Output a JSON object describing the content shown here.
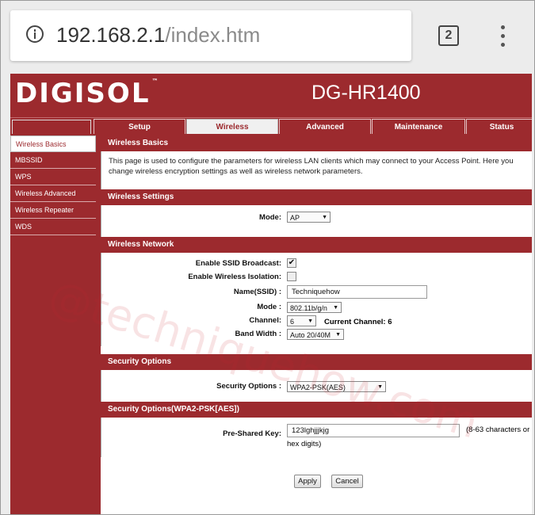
{
  "browser": {
    "url_host": "192.168.2.1",
    "url_path": "/index.htm",
    "tab_count": "2"
  },
  "header": {
    "logo": "DIGISOL",
    "logo_mark": "™",
    "model": "DG-HR1400"
  },
  "nav": {
    "tabs": [
      "Setup",
      "Wireless",
      "Advanced",
      "Maintenance",
      "Status"
    ],
    "active": "Wireless"
  },
  "sidebar": {
    "items": [
      "Wireless Basics",
      "MBSSID",
      "WPS",
      "Wireless Advanced",
      "Wireless Repeater",
      "WDS"
    ],
    "active": "Wireless Basics"
  },
  "sections": {
    "basics": {
      "title": "Wireless Basics",
      "text_line1": "This page is used to configure the parameters for wireless LAN clients which may connect to your Access Point. Here you",
      "text_line2": "change wireless encryption settings as well as wireless network parameters."
    },
    "settings": {
      "title": "Wireless Settings",
      "mode_label": "Mode:",
      "mode_value": "AP"
    },
    "network": {
      "title": "Wireless Network",
      "ssid_broadcast_label": "Enable SSID Broadcast:",
      "ssid_broadcast_checked": "✔",
      "isolation_label": "Enable Wireless Isolation:",
      "ssid_label": "Name(SSID) :",
      "ssid_value": "Techniquehow",
      "mode_label": "Mode :",
      "mode_value": "802.11b/g/n",
      "channel_label": "Channel:",
      "channel_value": "6",
      "current_channel_label": "Current Channel: 6",
      "bandwidth_label": "Band Width :",
      "bandwidth_value": "Auto 20/40M"
    },
    "security": {
      "title": "Security Options",
      "label": "Security Options :",
      "value": "WPA2-PSK(AES)"
    },
    "wpa": {
      "title": "Security Options(WPA2-PSK[AES])",
      "psk_label": "Pre-Shared Key:",
      "psk_value": "123lghjjjkjg",
      "hint_line1": "(8-63 characters or",
      "hint_line2": "hex digits)"
    }
  },
  "buttons": {
    "apply": "Apply",
    "cancel": "Cancel"
  },
  "watermark": "@techniquehow.com"
}
